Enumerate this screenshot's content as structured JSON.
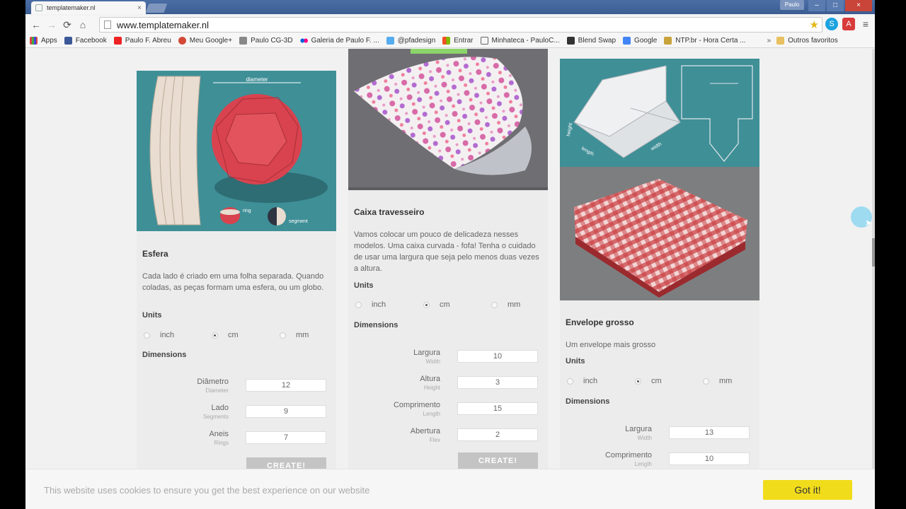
{
  "browser": {
    "tab_title": "templatemaker.nl",
    "url": "www.templatemaker.nl",
    "user": "Paulo",
    "bookmarks": [
      "Apps",
      "Facebook",
      "Paulo F. Abreu",
      "Meu Google+",
      "Paulo CG-3D",
      "Galeria de Paulo F. ...",
      "@pfadesign",
      "Entrar",
      "Minhateca - PauloC...",
      "Blend Swap",
      "Google",
      "NTP.br - Hora Certa ..."
    ],
    "bookmarks_more": "»",
    "other_bookmarks": "Outros favoritos"
  },
  "cards": [
    {
      "title": "Esfera",
      "description": "Cada lado é criado em uma folha separada. Quando coladas, as peças formam uma esfera, ou um globo.",
      "image_labels": {
        "diameter": "diameter",
        "ring": "ring",
        "segment": "segment"
      },
      "units_label": "Units",
      "units": [
        "inch",
        "cm",
        "mm"
      ],
      "selected_unit": "cm",
      "dimensions_label": "Dimensions",
      "fields": [
        {
          "label": "Diâmetro",
          "sub": "Diameter",
          "value": "12"
        },
        {
          "label": "Lado",
          "sub": "Segments",
          "value": "9"
        },
        {
          "label": "Aneis",
          "sub": "Rings",
          "value": "7"
        }
      ],
      "create": "CREATE!"
    },
    {
      "title": "Caixa travesseiro",
      "description": "Vamos colocar um pouco de delicadeza nesses modelos. Uma caixa curvada - fofa! Tenha o cuidado de usar uma largura que seja pelo menos duas vezes a altura.",
      "units_label": "Units",
      "units": [
        "inch",
        "cm",
        "mm"
      ],
      "selected_unit": "cm",
      "dimensions_label": "Dimensions",
      "fields": [
        {
          "label": "Largura",
          "sub": "Width",
          "value": "10"
        },
        {
          "label": "Altura",
          "sub": "Height",
          "value": "3"
        },
        {
          "label": "Comprimento",
          "sub": "Length",
          "value": "15"
        },
        {
          "label": "Abertura",
          "sub": "Flex",
          "value": "2"
        }
      ],
      "create": "CREATE!"
    },
    {
      "title": "Envelope grosso",
      "description": "Um envelope mais grosso",
      "image_labels": {
        "height": "height",
        "length": "length",
        "width": "width"
      },
      "units_label": "Units",
      "units": [
        "inch",
        "cm",
        "mm"
      ],
      "selected_unit": "cm",
      "dimensions_label": "Dimensions",
      "fields": [
        {
          "label": "Largura",
          "sub": "Width",
          "value": "13"
        },
        {
          "label": "Comprimento",
          "sub": "Length",
          "value": "10"
        }
      ]
    }
  ],
  "cookie": {
    "text": "This website uses cookies to ensure you get the best experience on our website",
    "button": "Got it!"
  },
  "colors": {
    "teal": "#3f8f97",
    "sphere_red": "#d8434f",
    "cookie_button": "#f1dc1b",
    "envelope_red": "#c93a3e"
  }
}
